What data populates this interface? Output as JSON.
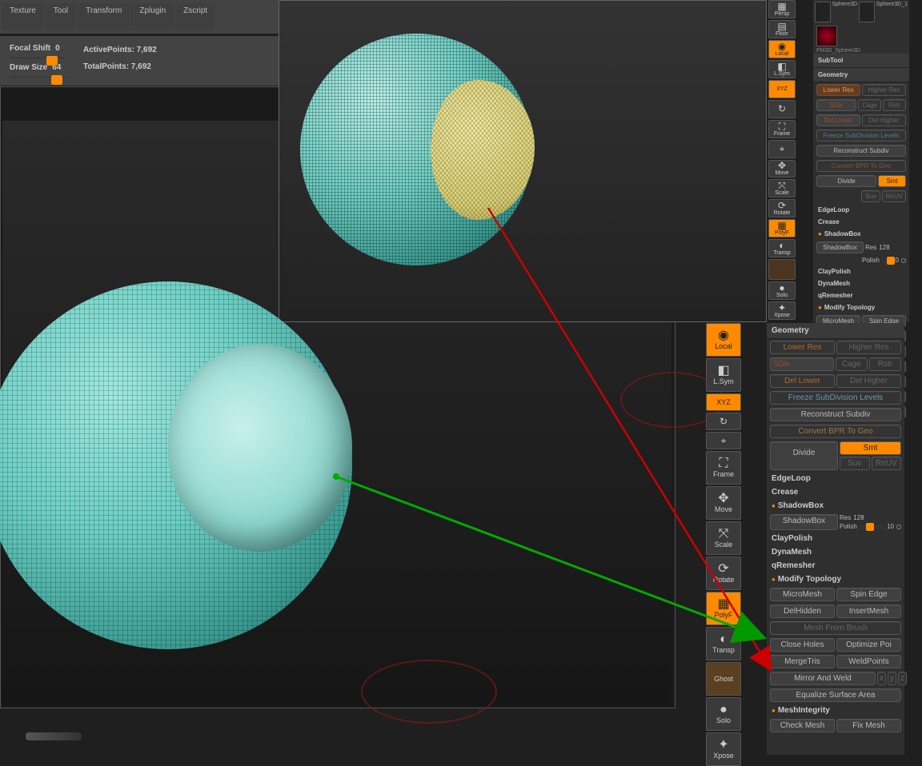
{
  "menu": {
    "texture": "Texture",
    "tool": "Tool",
    "transform": "Transform",
    "zplugin": "Zplugin",
    "zscript": "Zscript"
  },
  "ctrls": {
    "focal_label": "Focal Shift",
    "focal_val": "0",
    "draw_label": "Draw Size",
    "draw_val": "64",
    "active": "ActivePoints: 7,692",
    "total": "TotalPoints: 7,692"
  },
  "icons": {
    "persp": "Persp",
    "floor": "Floor",
    "local": "Local",
    "lsym": "L.Sym",
    "xyz": "XYZ",
    "cam": "↻",
    "frame": "Frame",
    "target": "⌖",
    "move": "Move",
    "scale": "Scale",
    "rotate": "Rotate",
    "polyf": "PolyF",
    "transp": "Transp",
    "ghost": "Ghost",
    "solo": "Solo",
    "xpose": "Xpose"
  },
  "subtool": {
    "a": "Sphere3D",
    "b": "Sphere3D_1",
    "pm": "PM3D_Sphere3D",
    "header": "SubTool"
  },
  "geo": {
    "header": "Geometry",
    "lower": "Lower Res",
    "higher": "Higher Res",
    "sdiv": "SDiv",
    "cage": "Cage",
    "rstr": "Rstr",
    "dellower": "Del Lower",
    "delhigher": "Del Higher",
    "freeze": "Freeze SubDivision Levels",
    "reconstruct": "Reconstruct Subdiv",
    "convert": "Convert BPR To Geo",
    "divide": "Divide",
    "smt": "Smt",
    "suv": "Suv",
    "reuv": "ReUV",
    "edgeloop": "EdgeLoop",
    "crease": "Crease",
    "shadowbox": "ShadowBox",
    "shadowboxbtn": "ShadowBox",
    "res": "Res",
    "resval": "128",
    "polish": "Polish",
    "polishval": "10",
    "claypolish": "ClayPolish",
    "dynamesh": "DynaMesh",
    "qremesher": "qRemesher",
    "modtopo": "Modify Topology",
    "micromesh": "MicroMesh",
    "spinedge": "Spin Edge",
    "delhidden": "DelHidden",
    "insertmesh": "InsertMesh",
    "meshfrombrush": "Mesh From Brush",
    "closeholes": "Close Holes",
    "optimize": "Optimize Poi",
    "mergetris": "MergeTris",
    "weldpoints": "WeldPoints",
    "mirrorweld": "Mirror And Weld",
    "equalize": "Equalize Surface Area",
    "meshintegrity": "MeshIntegrity",
    "checkmesh": "Check Mesh",
    "fixmesh": "Fix Mesh"
  }
}
